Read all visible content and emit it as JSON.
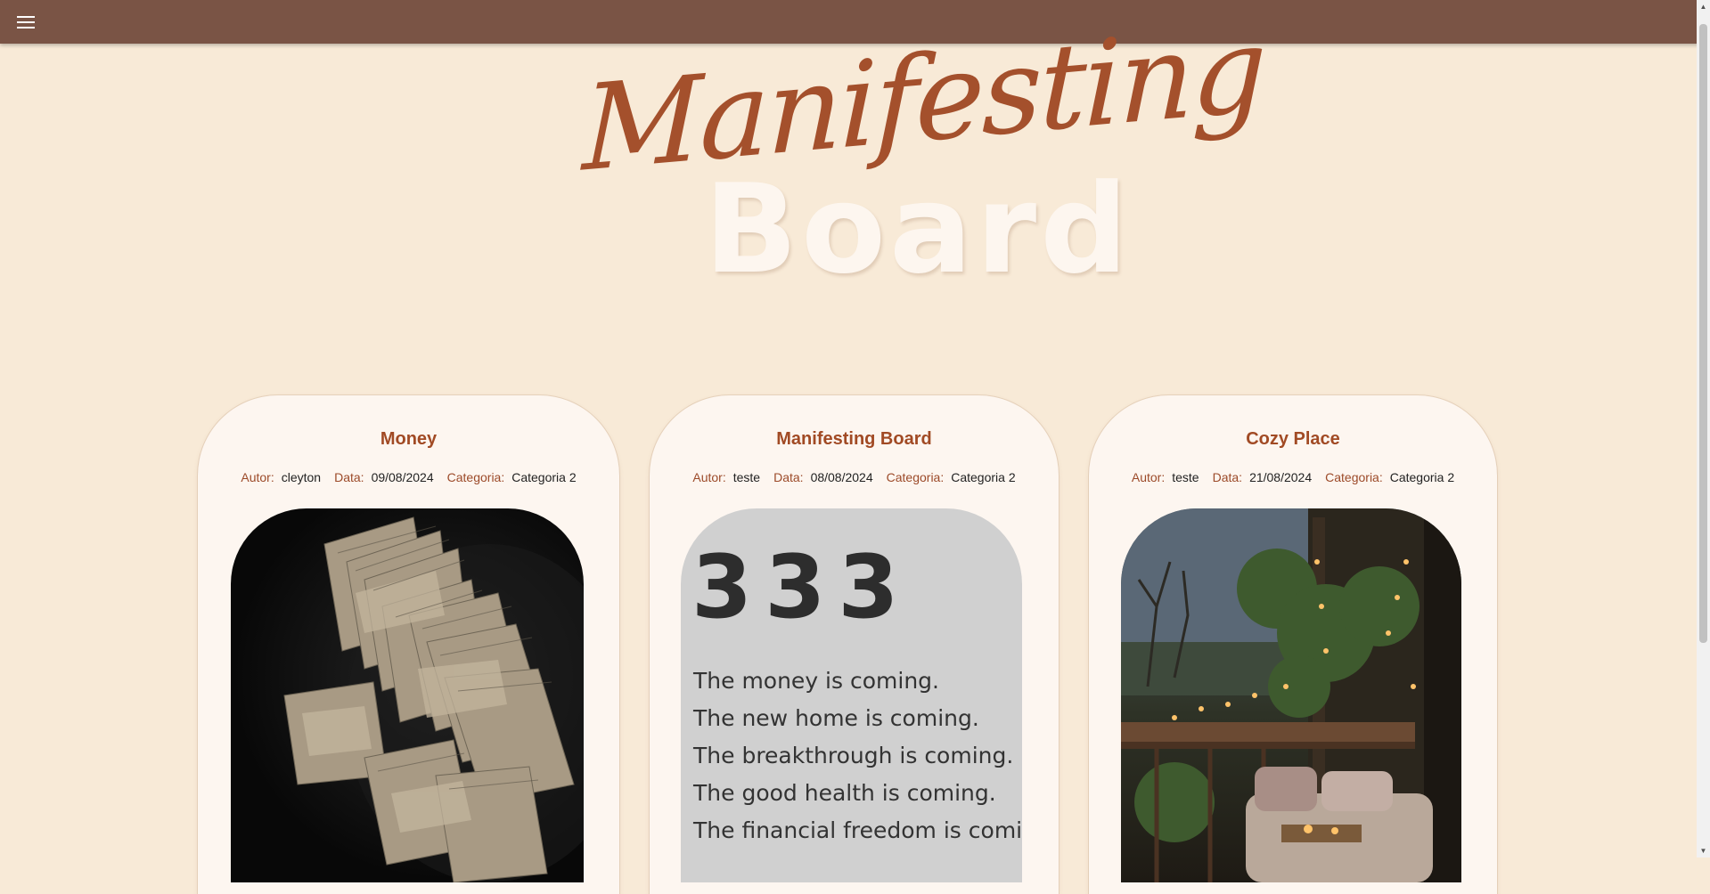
{
  "header": {
    "menu_icon": "hamburger-menu-icon",
    "title_script": "Manifesting",
    "title_bold": "Board"
  },
  "cards": [
    {
      "title": "Money",
      "author_label": "Autor:",
      "author": "cleyton",
      "date_label": "Data:",
      "date": "09/08/2024",
      "category_label": "Categoria:",
      "category": "Categoria 2"
    },
    {
      "title": "Manifesting Board",
      "author_label": "Autor:",
      "author": "teste",
      "date_label": "Data:",
      "date": "08/08/2024",
      "category_label": "Categoria:",
      "category": "Categoria 2",
      "quote_number": "333",
      "quote_lines": [
        "The money is coming.",
        "The new home is coming.",
        "The breakthrough is coming.",
        "The good health is coming.",
        "The financial freedom is comin"
      ]
    },
    {
      "title": "Cozy Place",
      "author_label": "Autor:",
      "author": "teste",
      "date_label": "Data:",
      "date": "21/08/2024",
      "category_label": "Categoria:",
      "category": "Categoria 2"
    }
  ]
}
